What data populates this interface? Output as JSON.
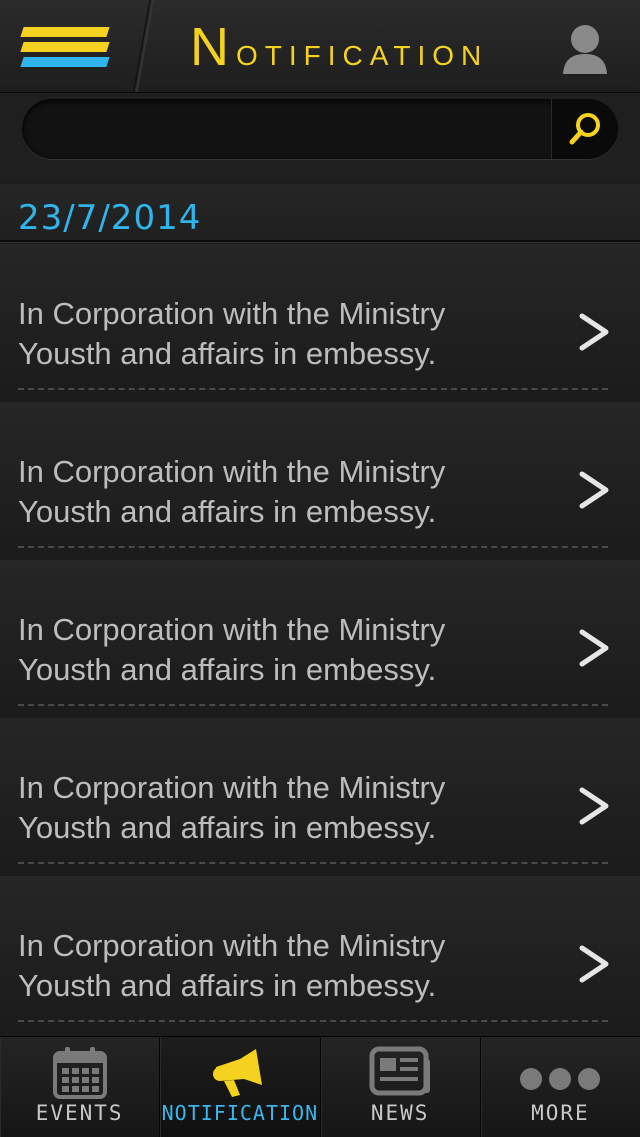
{
  "colors": {
    "accent_yellow": "#f4d21f",
    "accent_blue": "#2fb5ec",
    "text_gray": "#bdbdbd"
  },
  "header": {
    "title_initial": "N",
    "title_rest": "OTIFICATION",
    "menu_icon": "hamburger-menu-icon",
    "profile_icon": "user-profile-icon"
  },
  "search": {
    "value": "",
    "placeholder": "",
    "icon": "search-icon"
  },
  "date_header": "23/7/2014",
  "notifications": [
    {
      "line1": "In Corporation with the Ministry",
      "line2": "Yousth and affairs in embessy."
    },
    {
      "line1": "In Corporation with the Ministry",
      "line2": "Yousth and affairs in embessy."
    },
    {
      "line1": "In Corporation with the Ministry",
      "line2": "Yousth and affairs in embessy."
    },
    {
      "line1": "In Corporation with the Ministry",
      "line2": "Yousth and affairs in embessy."
    },
    {
      "line1": "In Corporation with the Ministry",
      "line2": "Yousth and affairs in embessy."
    }
  ],
  "tabs": [
    {
      "label": "EVENTS",
      "icon": "calendar-icon",
      "active": false
    },
    {
      "label": "NOTIFICATION",
      "icon": "megaphone-icon",
      "active": true
    },
    {
      "label": "NEWS",
      "icon": "newspaper-icon",
      "active": false
    },
    {
      "label": "MORE",
      "icon": "more-dots-icon",
      "active": false
    }
  ]
}
